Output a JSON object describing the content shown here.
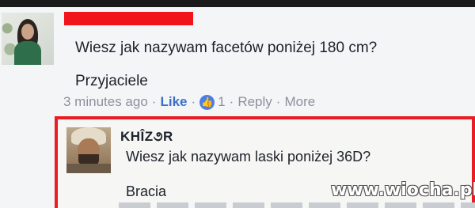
{
  "comment": {
    "author_redacted": true,
    "line1": "Wiesz jak nazywam facetów poniżej 180 cm?",
    "line2": "Przyjaciele",
    "meta": {
      "time": "3 minutes ago",
      "like": "Like",
      "like_count": "1",
      "reply": "Reply",
      "more": "More",
      "dot": "·"
    }
  },
  "reply": {
    "author": "KHÎZ૭R",
    "line1": "Wiesz jak nazywam laski poniżej 36D?",
    "line2": "Bracia"
  },
  "watermark": "www.wiocha.pl",
  "colors": {
    "highlight_red": "#ea1b22",
    "like_blue": "#4a7fe6",
    "meta_gray": "#8b929c"
  }
}
